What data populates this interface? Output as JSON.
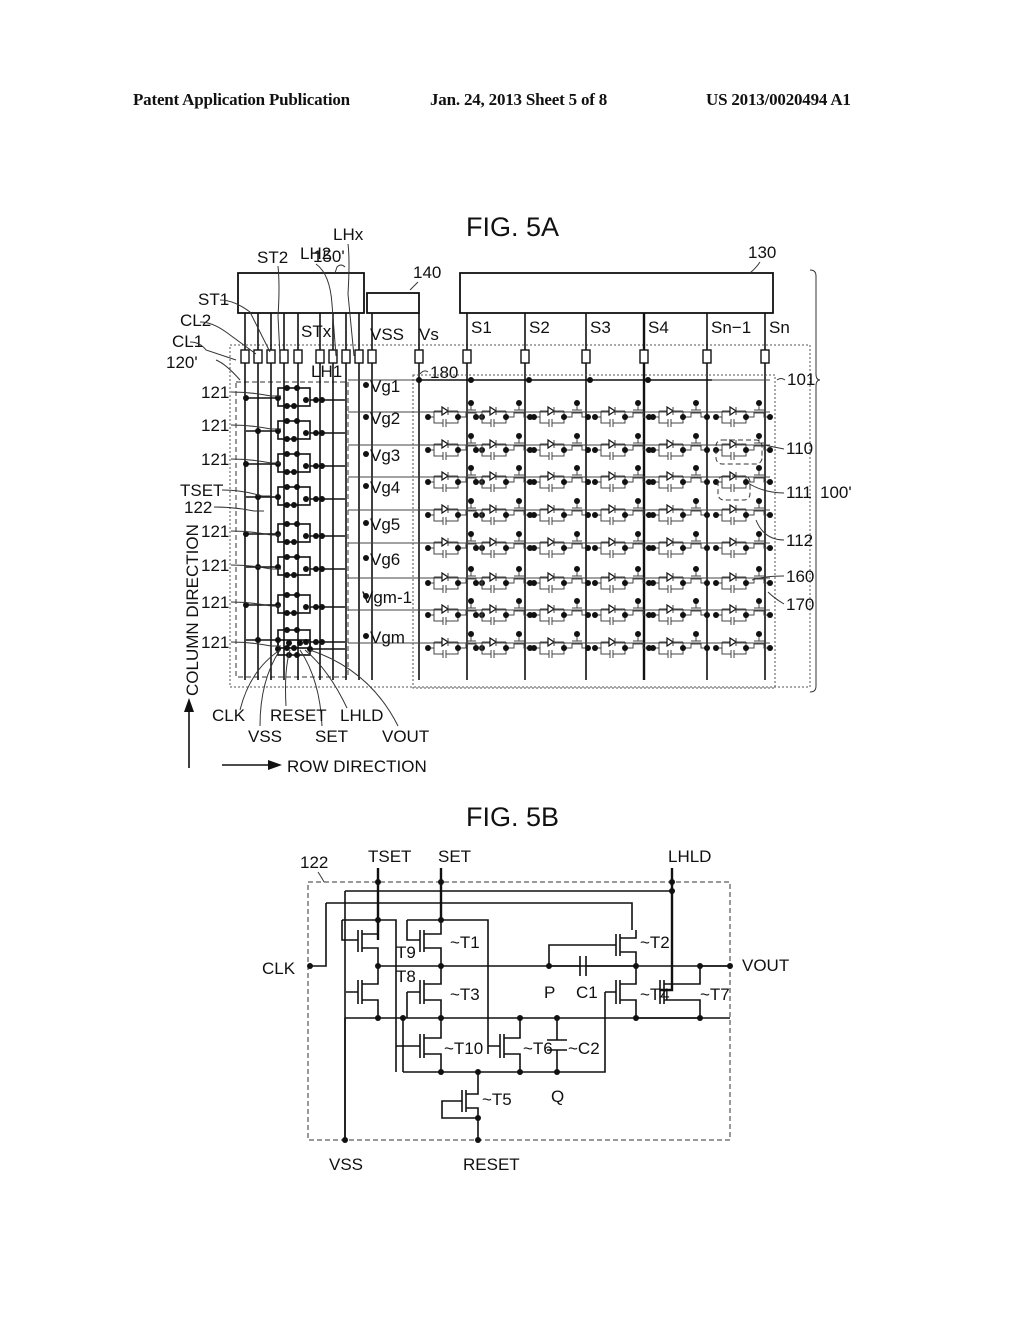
{
  "header": {
    "publication": "Patent Application Publication",
    "date_sheet": "Jan. 24, 2013   Sheet 5 of 8",
    "number": "US 2013/0020494 A1"
  },
  "fig5a": {
    "title": "FIG. 5A",
    "blocks": {
      "gate_driver_ctrl": "150'",
      "power_supply": "140",
      "data_driver": "130",
      "pixel_array": "101",
      "panel": "100'",
      "shift_register": "120'"
    },
    "pad_labels": {
      "cl1": "CL1",
      "cl2": "CL2",
      "st1": "ST1",
      "st2": "ST2",
      "stx": "STx",
      "lh1": "LH1",
      "lh2": "LH2",
      "lhx": "LHx",
      "vss": "VSS",
      "vs": "Vs"
    },
    "vs_line": "180",
    "source_lines": [
      "S1",
      "S2",
      "S3",
      "S4",
      "Sn−1",
      "Sn"
    ],
    "gate_lines": [
      "Vg1",
      "Vg2",
      "Vg3",
      "Vg4",
      "Vg5",
      "Vg6",
      "Vgm-1",
      "Vgm"
    ],
    "stage_labels": [
      "121",
      "121",
      "121",
      "TSET",
      "122",
      "121",
      "121",
      "121",
      "121"
    ],
    "right_labels": [
      "110",
      "111",
      "112",
      "160",
      "170"
    ],
    "bottom_labels": {
      "clk": "CLK",
      "vss": "VSS",
      "reset": "RESET",
      "set": "SET",
      "lhld": "LHLD",
      "vout": "VOUT"
    },
    "column_direction": "COLUMN DIRECTION",
    "row_direction": "ROW DIRECTION"
  },
  "fig5b": {
    "title": "FIG. 5B",
    "block_ref": "122",
    "terminals": {
      "tset": "TSET",
      "set": "SET",
      "lhld": "LHLD",
      "clk": "CLK",
      "vout": "VOUT",
      "vss": "VSS",
      "reset": "RESET"
    },
    "transistors": {
      "t1": "~T1",
      "t2": "~T2",
      "t3": "~T3",
      "t4": "~T4",
      "t5": "~T5",
      "t6": "~T6",
      "t7": "~T7",
      "t8": "T8",
      "t9": "T9",
      "t10": "~T10"
    },
    "capacitors": {
      "c1": "C1",
      "c2": "~C2"
    },
    "nodes": {
      "p": "P",
      "q": "Q"
    }
  }
}
